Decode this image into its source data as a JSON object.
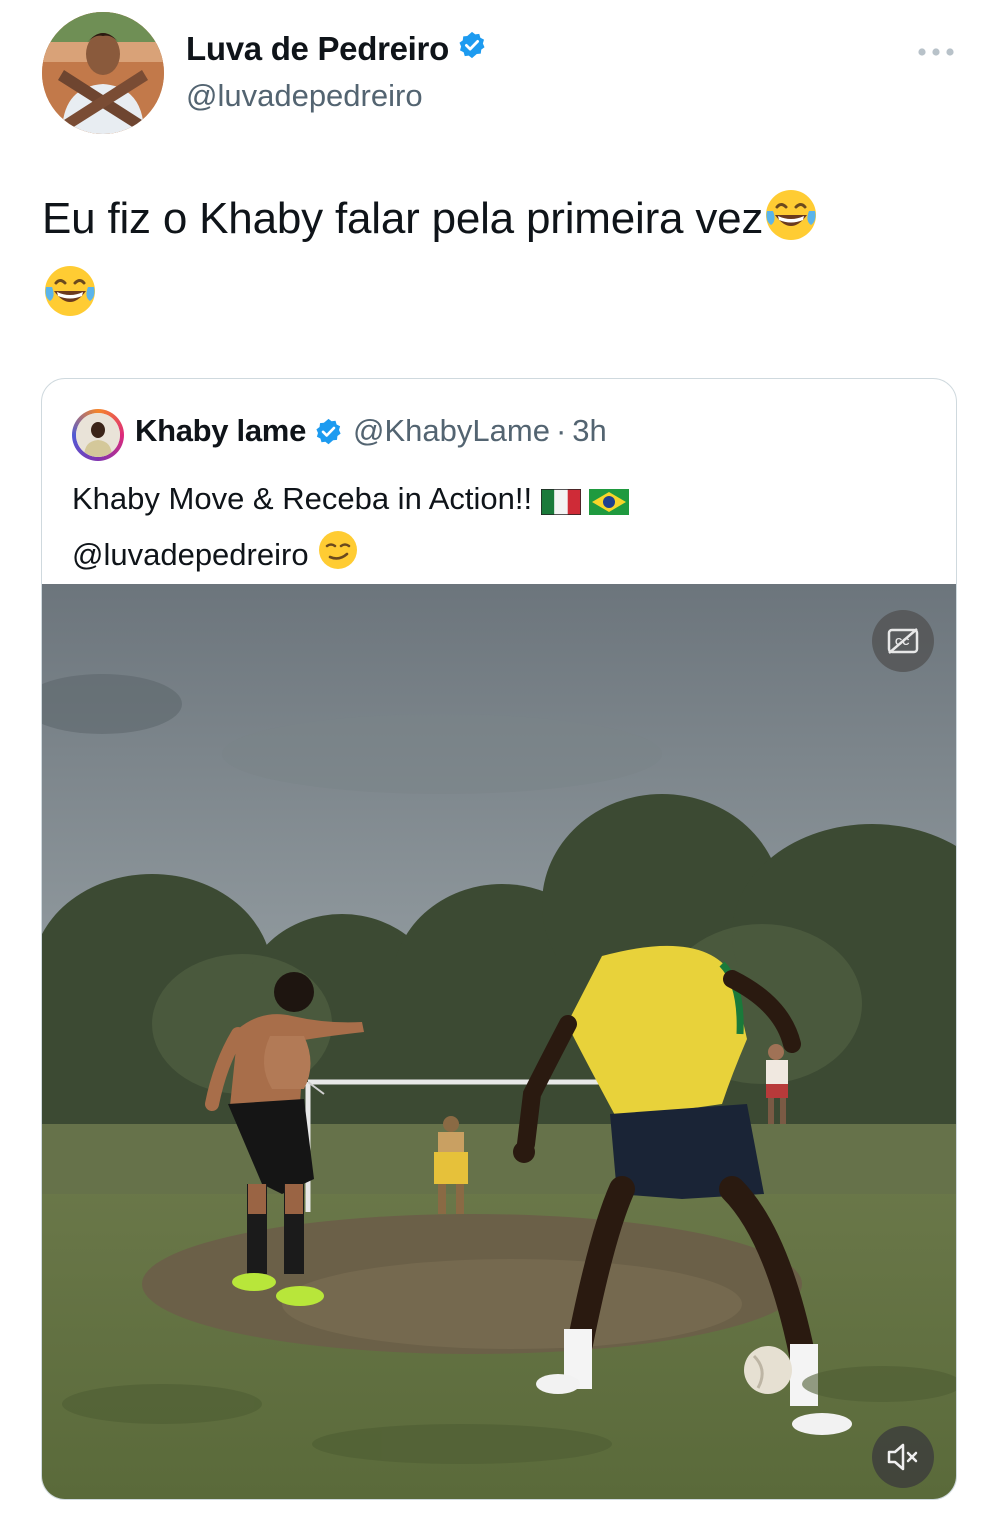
{
  "tweet": {
    "author": {
      "name": "Luva de Pedreiro",
      "handle": "@luvadepedreiro",
      "verified": true
    },
    "text": "Eu fiz o Khaby falar pela primeira vez",
    "emoji": [
      "face-with-tears-of-joy",
      "face-with-tears-of-joy"
    ],
    "more_icon": "more-dots-icon"
  },
  "quote": {
    "author": {
      "name": "Khaby lame",
      "handle": "@KhabyLame",
      "separator": "·",
      "time": "3h",
      "verified": true
    },
    "text_line1": "Khaby Move & Receba in Action!!",
    "text_line2": "@luvadepedreiro",
    "flags": [
      "italy-flag",
      "brazil-flag"
    ],
    "emoji_end": "smirking-face",
    "video": {
      "controls": [
        "captions-off-icon",
        "mute-icon"
      ]
    }
  },
  "colors": {
    "verified_blue": "#1d9bf0",
    "text_primary": "#0f1419",
    "text_secondary": "#536471",
    "border": "#cfd9de"
  }
}
